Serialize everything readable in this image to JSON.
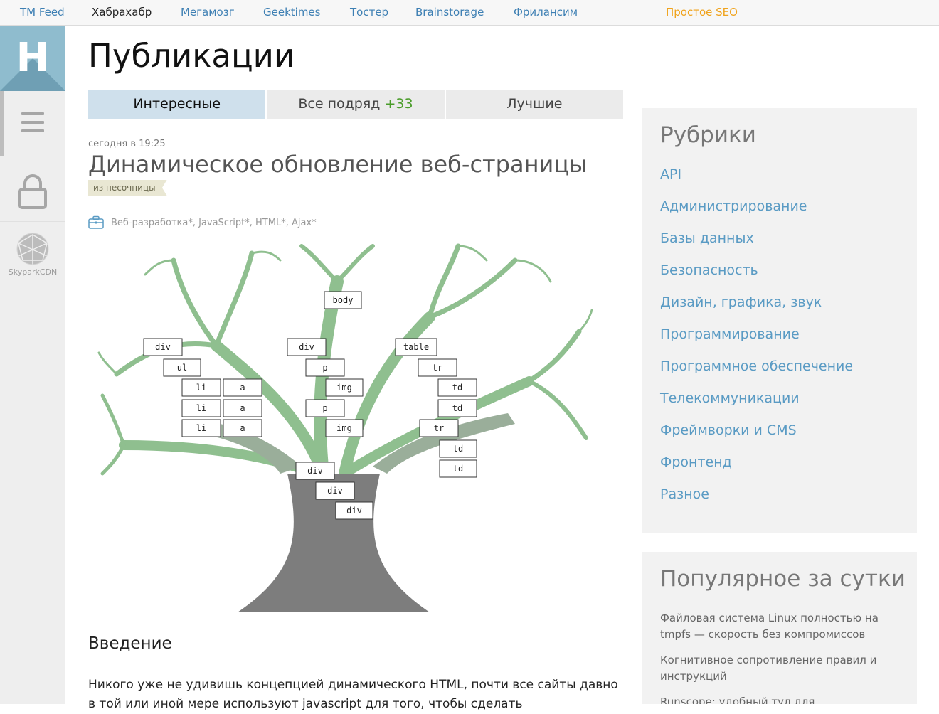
{
  "topnav": {
    "links": [
      "TM Feed",
      "Хабрахабр",
      "Мегамозг",
      "Geektimes",
      "Тостер",
      "Brainstorage",
      "Фрилансим"
    ],
    "promo": "Простое SEO"
  },
  "rail": {
    "logo_letter": "H",
    "cdn_label": "SkyparkCDN"
  },
  "main": {
    "page_title": "Публикации",
    "tabs": [
      {
        "label": "Интересные",
        "count": ""
      },
      {
        "label": "Все подряд",
        "count": "+33"
      },
      {
        "label": "Лучшие",
        "count": ""
      }
    ]
  },
  "post": {
    "date": "сегодня в 19:25",
    "title": "Динамическое обновление веб-страницы",
    "badge": "из песочницы",
    "hubs": "Веб-разработка*, JavaScript*, HTML*, Ajax*",
    "tree_labels": {
      "body": "body",
      "div": "div",
      "ul": "ul",
      "li": "li",
      "a": "a",
      "p": "p",
      "img": "img",
      "table": "table",
      "tr": "tr",
      "td": "td"
    },
    "intro_heading": "Введение",
    "intro_text": "Никого уже не удивишь концепцией динамического HTML, почти все сайты давно в той или иной мере используют javascript для того, чтобы сделать"
  },
  "sidebar": {
    "rubrics_title": "Рубрики",
    "rubrics": [
      "API",
      "Администрирование",
      "Базы данных",
      "Безопасность",
      "Дизайн, графика, звук",
      "Программирование",
      "Программное обеспечение",
      "Телекоммуникации",
      "Фреймворки и CMS",
      "Фронтенд",
      "Разное"
    ],
    "popular_title": "Популярное за сутки",
    "popular": [
      "Файловая система Linux полностью на tmpfs — скорость без компромиссов",
      "Когнитивное сопротивление правил и инструкций",
      "Runscope: удобный тул для"
    ]
  },
  "colors": {
    "link": "#3d7fb3",
    "promo": "#f0a31c",
    "logo_bg": "#8fbcce",
    "tab_active": "#cfe0ec",
    "count_green": "#4a9c2a",
    "rubric_link": "#5a9bc4",
    "tree_green": "#8fbf8f",
    "trunk": "#7d7d7d"
  },
  "icons": [
    "menu-icon",
    "lock-icon",
    "globe-icon",
    "briefcase-icon"
  ]
}
